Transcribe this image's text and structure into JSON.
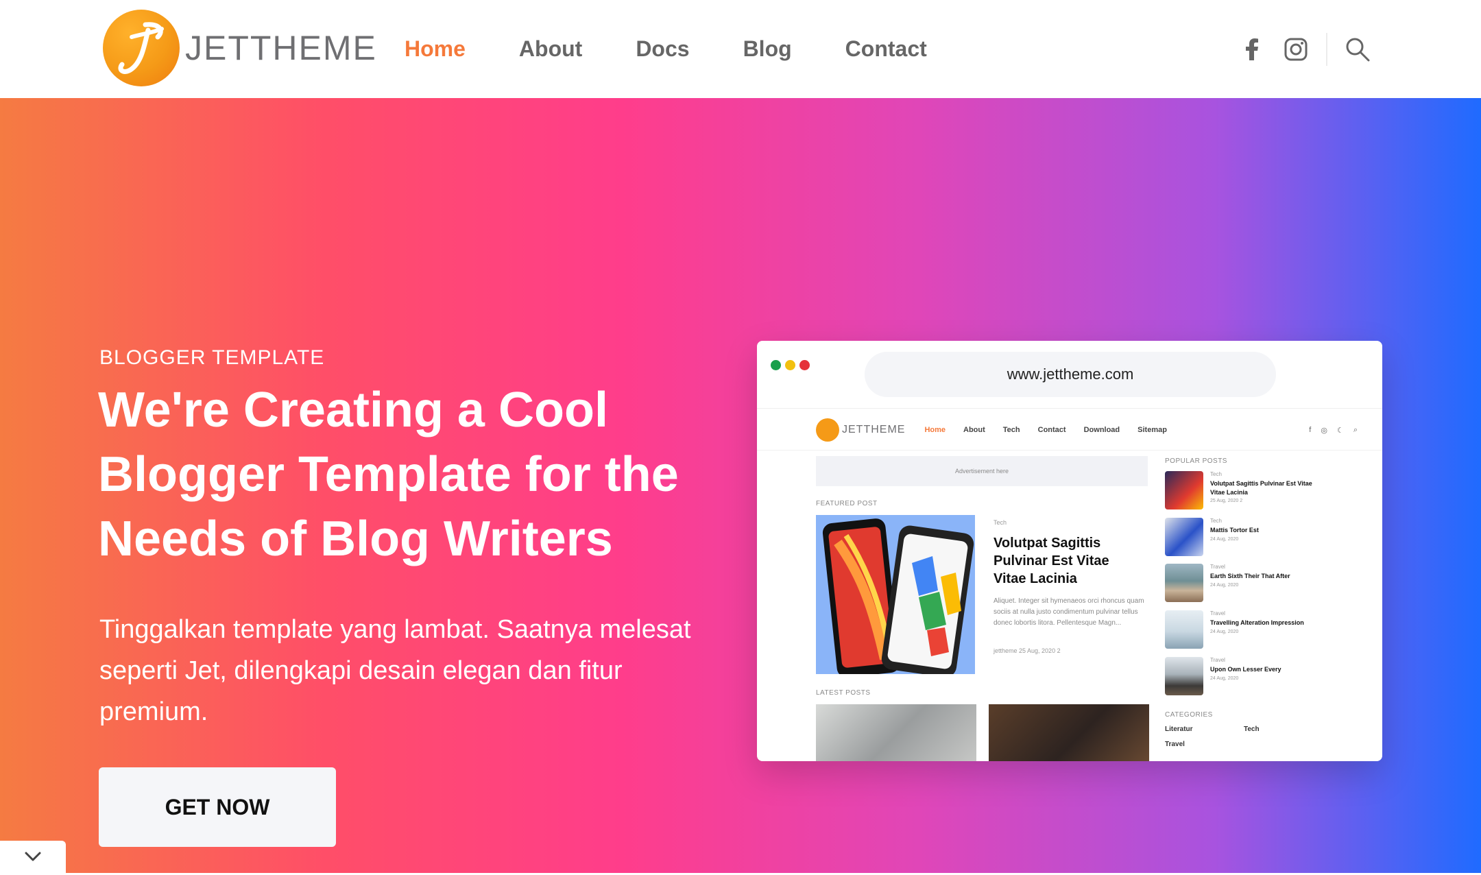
{
  "brand": {
    "name": "JETTHEME"
  },
  "nav": {
    "items": [
      "Home",
      "About",
      "Docs",
      "Blog",
      "Contact"
    ],
    "active": "Home"
  },
  "header_icons": [
    "facebook-icon",
    "instagram-icon",
    "search-icon"
  ],
  "hero": {
    "eyebrow": "BLOGGER TEMPLATE",
    "headline": "We're Creating a Cool Blogger Template for the Needs of Blog Writers",
    "lead": "Tinggalkan template yang lambat. Saatnya melesat seperti Jet, dilengkapi desain elegan dan fitur premium.",
    "cta": "GET NOW"
  },
  "mockup": {
    "url": "www.jettheme.com",
    "brand": "JETTHEME",
    "nav": [
      "Home",
      "About",
      "Tech",
      "Contact",
      "Download",
      "Sitemap"
    ],
    "advertisement": "Advertisement here",
    "featured_label": "FEATURED POST",
    "featured": {
      "category": "Tech",
      "title": "Volutpat Sagittis Pulvinar Est Vitae Vitae Lacinia",
      "excerpt": "Aliquet. Integer sit hymenaeos orci rhoncus quam sociis at nulla justo condimentum pulvinar tellus donec lobortis litora. Pellentesque Magn...",
      "meta": "jettheme  25 Aug, 2020  2"
    },
    "latest_label": "LATEST POSTS",
    "popular_label": "POPULAR POSTS",
    "popular": [
      {
        "category": "Tech",
        "title": "Volutpat Sagittis Pulvinar Est Vitae Vitae Lacinia",
        "meta": "25 Aug, 2020  2"
      },
      {
        "category": "Tech",
        "title": "Mattis Tortor Est",
        "meta": "24 Aug, 2020"
      },
      {
        "category": "Travel",
        "title": "Earth Sixth Their That After",
        "meta": "24 Aug, 2020"
      },
      {
        "category": "Travel",
        "title": "Travelling Alteration Impression",
        "meta": "24 Aug, 2020"
      },
      {
        "category": "Travel",
        "title": "Upon Own Lesser Every",
        "meta": "24 Aug, 2020"
      }
    ],
    "categories_label": "CATEGORIES",
    "categories": [
      "Literatur",
      "Tech",
      "Travel"
    ]
  },
  "colors": {
    "accent": "#f5793a",
    "gradient": [
      "#f57b42",
      "#ff4e68",
      "#ff3d8b",
      "#e046b8",
      "#a853df",
      "#1f6bff"
    ],
    "window_dots": [
      "#1a9f4b",
      "#f2c00f",
      "#e5333b"
    ]
  }
}
